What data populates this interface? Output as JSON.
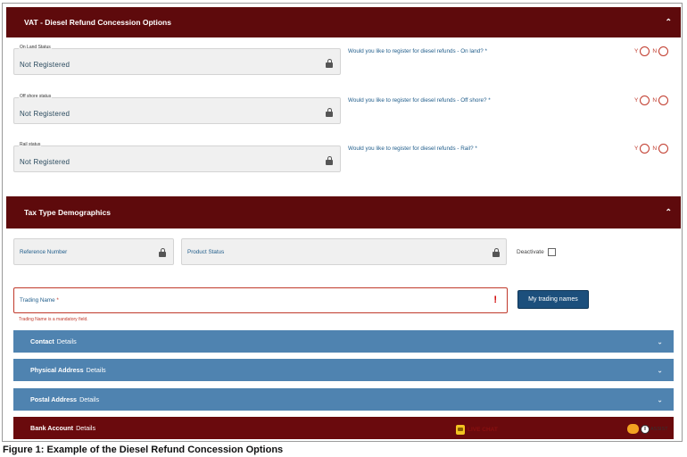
{
  "concession": {
    "title": "VAT - Diesel Refund Concession Options",
    "rows": [
      {
        "status_label": "On Land Status",
        "status_value": "Not Registered",
        "question": "Would you like to register for diesel refunds - On land? *"
      },
      {
        "status_label": "Off shore status",
        "status_value": "Not Registered",
        "question": "Would you like to register for diesel refunds - Off shore? *"
      },
      {
        "status_label": "Rail status",
        "status_value": "Not Registered",
        "question": "Would you like to register for diesel refunds - Rail? *"
      }
    ],
    "yes_label": "Y",
    "no_label": "N"
  },
  "demographics": {
    "title": "Tax Type Demographics",
    "reference_label": "Reference Number",
    "product_status_label": "Product Status",
    "deactivate_label": "Deactivate",
    "trading_name_label": "Trading Name",
    "trading_name_required": "*",
    "trading_name_error": "Trading Name is a mandatory field.",
    "trading_names_button": "My trading names"
  },
  "accordions": [
    {
      "bold": "Contact",
      "rest": "Details"
    },
    {
      "bold": "Physical Address",
      "rest": "Details"
    },
    {
      "bold": "Postal Address",
      "rest": "Details"
    },
    {
      "bold": "Bank Account",
      "rest": "Details"
    }
  ],
  "live_chat_label": "LIVE CHAT",
  "assist_label": "ASSIST",
  "caption": "Figure 1: Example of the Diesel Refund Concession Options",
  "colors": {
    "header_maroon": "#5e0a0c",
    "accordion_blue": "#4f83b0",
    "button_blue": "#1c4f7c",
    "error_red": "#c0392b"
  },
  "icons": {
    "lock": "lock-icon",
    "chevron_up": "chevron-up-icon",
    "chevron_down": "chevron-down-icon",
    "error": "exclamation-icon",
    "chat": "chat-icon",
    "info": "info-icon"
  }
}
